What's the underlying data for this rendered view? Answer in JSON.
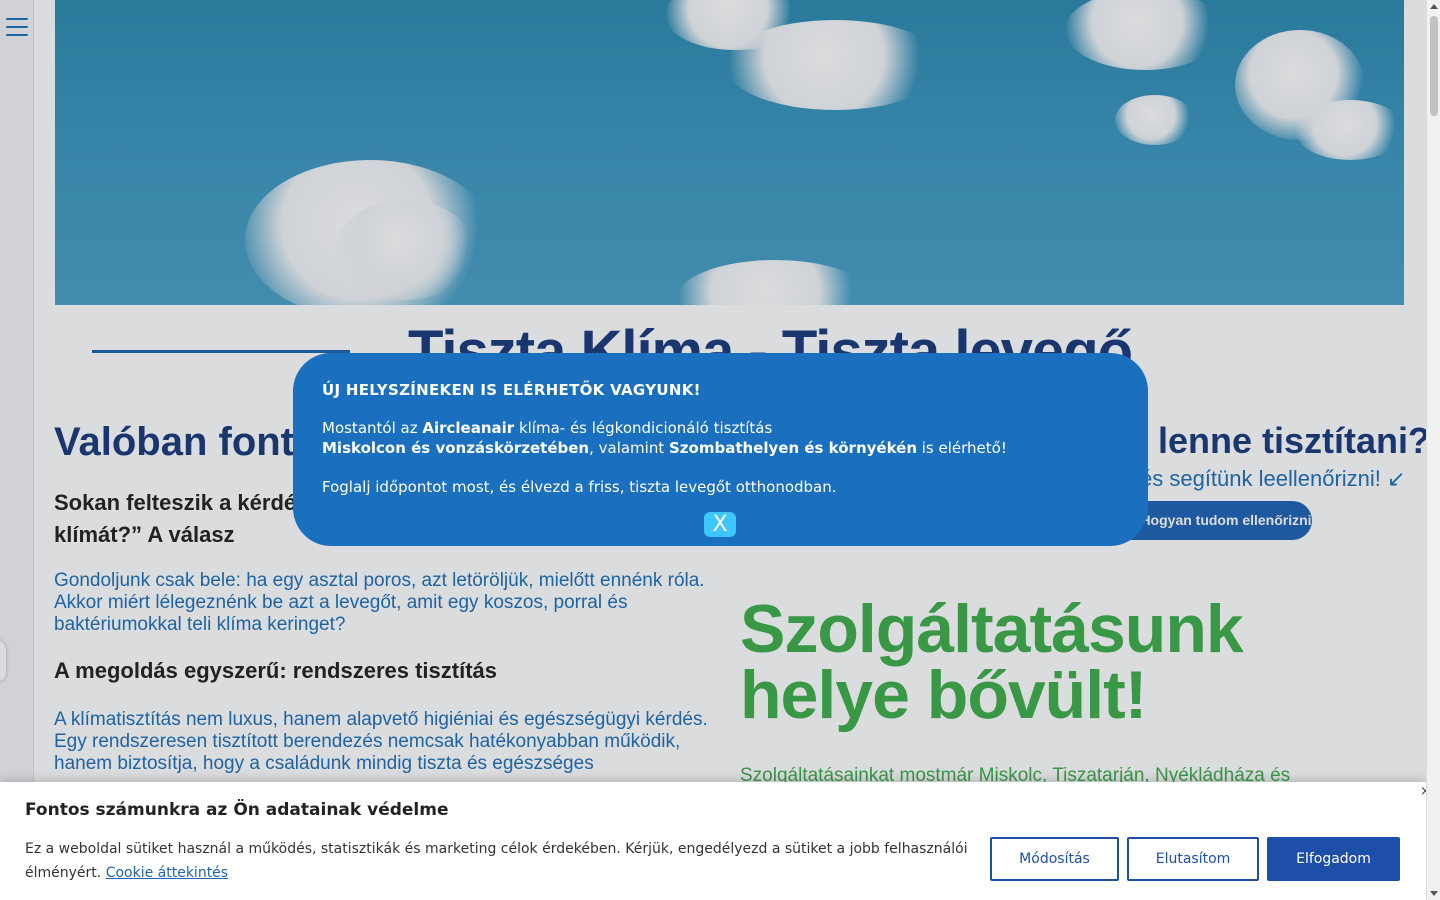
{
  "menu": {
    "icon": "hamburger-menu-icon"
  },
  "hero": {
    "image": "sky-with-clouds"
  },
  "main": {
    "title": "Tiszta Klíma - Tiszta levegő",
    "left_heading": "Valóban fontos",
    "lead": "Sokan felteszik a kérdést: „Valóban fontos tisztítani a klímát?” A válasz",
    "paragraph1": "Gondoljunk csak bele: ha egy asztal poros, azt letöröljük, mielőtt ennénk róla. Akkor miért lélegeznénk be azt a levegőt, amit egy koszos, porral és baktériumokkal teli klíma keringet?",
    "subheading": "A megoldás egyszerű: rendszeres tisztítás",
    "paragraph2": "A klímatisztítás nem luxus, hanem alapvető higiéniai és egészségügyi kérdés. Egy rendszeresen tisztított berendezés nemcsak hatékonyabban működik, hanem biztosítja, hogy a családunk mindig tiszta és egészséges",
    "right_heading": "lenne tisztítani?",
    "right_subtext": "és segítünk leellenőrizni! ↙",
    "check_button": "Hogyan tudom ellenőrizni",
    "green_title": "Szolgáltatásunk helye bővült!",
    "green_text": "Szolgáltatásainkat mostmár Miskolc, Tiszatarján, Nyékládháza és"
  },
  "popup": {
    "title": "ÚJ HELYSZÍNEKEN IS ELÉRHETŐK VAGYUNK!",
    "line1_pre": "Mostantól az ",
    "line1_bold": "Aircleanair",
    "line1_post": " klíma- és légkondicionáló tisztítás",
    "line2_bold1": "Miskolcon és vonzáskörzetében",
    "line2_mid": ", valamint ",
    "line2_bold2": "Szombathelyen és környékén",
    "line2_post": " is elérhető!",
    "line3": "Foglalj időpontot most, és élvezd a friss, tiszta levegőt otthonodban.",
    "close_label": "X"
  },
  "cookie": {
    "title": "Fontos számunkra az Ön adatainak védelme",
    "text": "Ez a weboldal sütiket használ a működés, statisztikák és marketing célok érdekében. Kérjük, engedélyezd a sütiket a jobb felhasználói élményért.",
    "link": "Cookie áttekintés",
    "btn_modify": "Módosítás",
    "btn_reject": "Elutasítom",
    "btn_accept": "Elfogadom",
    "close": "×"
  },
  "colors": {
    "primary": "#1e63b5",
    "popup": "#1a6fbe",
    "green": "#3fae4a",
    "navy": "#1a3a7a"
  }
}
